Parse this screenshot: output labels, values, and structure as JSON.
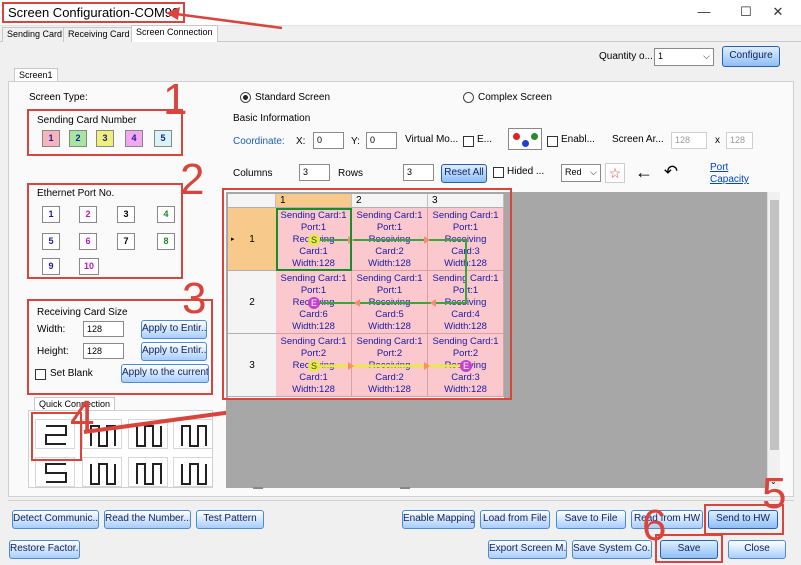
{
  "window": {
    "title": "Screen Configuration-COM99",
    "minimize": "—",
    "maximize": "☐",
    "close": "✕"
  },
  "tabs": [
    "Sending Card",
    "Receiving Card",
    "Screen Connection"
  ],
  "quantity": {
    "label": "Quantity o...",
    "value": "1",
    "configure_label": "Configure"
  },
  "screen_tab": "Screen1",
  "screen_type": {
    "label": "Screen Type:",
    "standard": "Standard Screen",
    "complex": "Complex Screen",
    "selected": "standard"
  },
  "sending_card_number": {
    "title": "Sending Card Number",
    "items": [
      {
        "label": "1",
        "color": "#f8b4bc"
      },
      {
        "label": "2",
        "color": "#a8e6a0"
      },
      {
        "label": "3",
        "color": "#eef07a"
      },
      {
        "label": "4",
        "color": "#f2a8f0"
      },
      {
        "label": "5",
        "color": "#d8f4f4"
      }
    ]
  },
  "ethernet_port": {
    "title": "Ethernet Port No.",
    "items": [
      "1",
      "2",
      "3",
      "4",
      "5",
      "6",
      "7",
      "8",
      "9",
      "10"
    ]
  },
  "receiving_card_size": {
    "title": "Receiving Card Size",
    "width_label": "Width:",
    "width_value": "128",
    "height_label": "Height:",
    "height_value": "128",
    "apply_entire_1": "Apply to Entir...",
    "apply_entire_2": "Apply to Entir...",
    "set_blank": "Set Blank",
    "apply_current": "Apply to the current..."
  },
  "quick_connection": {
    "label": "Quick Connection"
  },
  "basic_info": {
    "title": "Basic Information",
    "coordinate": "Coordinate:",
    "x_label": "X:",
    "x_value": "0",
    "y_label": "Y:",
    "y_value": "0",
    "virtual_mode": "Virtual Mo...",
    "e_label": "E...",
    "enable_label": "Enabl...",
    "screen_area": "Screen Ar...",
    "area_w": "128",
    "area_x": "x",
    "area_h": "128",
    "columns_label": "Columns",
    "columns_value": "3",
    "rows_label": "Rows",
    "rows_value": "3",
    "reset_all": "Reset All",
    "hided_label": "Hided ...",
    "color_select": "Red",
    "port_capacity_1": "Port",
    "port_capacity_2": "Capacity"
  },
  "grid": {
    "columns": [
      "1",
      "2",
      "3"
    ],
    "rows": [
      {
        "label": "1",
        "cells": [
          [
            "Sending Card:1",
            "Port:1",
            "Receiving",
            "Card:1",
            "Width:128"
          ],
          [
            "Sending Card:1",
            "Port:1",
            "Receiving",
            "Card:2",
            "Width:128"
          ],
          [
            "Sending Card:1",
            "Port:1",
            "Receiving",
            "Card:3",
            "Width:128"
          ]
        ]
      },
      {
        "label": "2",
        "cells": [
          [
            "Sending Card:1",
            "Port:1",
            "Receiving",
            "Card:6",
            "Width:128"
          ],
          [
            "Sending Card:1",
            "Port:1",
            "Receiving",
            "Card:5",
            "Width:128"
          ],
          [
            "Sending Card:1",
            "Port:1",
            "Receiving",
            "Card:4",
            "Width:128"
          ]
        ]
      },
      {
        "label": "3",
        "cells": [
          [
            "Sending Card:1",
            "Port:2",
            "Receiving",
            "Card:1",
            "Width:128"
          ],
          [
            "Sending Card:1",
            "Port:2",
            "Receiving",
            "Card:2",
            "Width:128"
          ],
          [
            "Sending Card:1",
            "Port:2",
            "Receiving",
            "Card:3",
            "Width:128"
          ]
        ]
      }
    ],
    "start_marker": "S",
    "end_marker": "E",
    "port1_color": "#3aa63a",
    "port2_color": "#e8e84a"
  },
  "annotations": [
    "1",
    "2",
    "3",
    "4",
    "5",
    "6"
  ],
  "buttons": {
    "detect": "Detect Communic...",
    "read_number": "Read the Number...",
    "test_pattern": "Test Pattern",
    "enable_mapping": "Enable Mapping",
    "load_file": "Load from File",
    "save_file": "Save to File",
    "read_hw": "Read from HW",
    "send_hw": "Send to HW",
    "restore": "Restore Factor...",
    "export": "Export Screen M...",
    "save_system": "Save System Co...",
    "save": "Save",
    "close": "Close"
  }
}
